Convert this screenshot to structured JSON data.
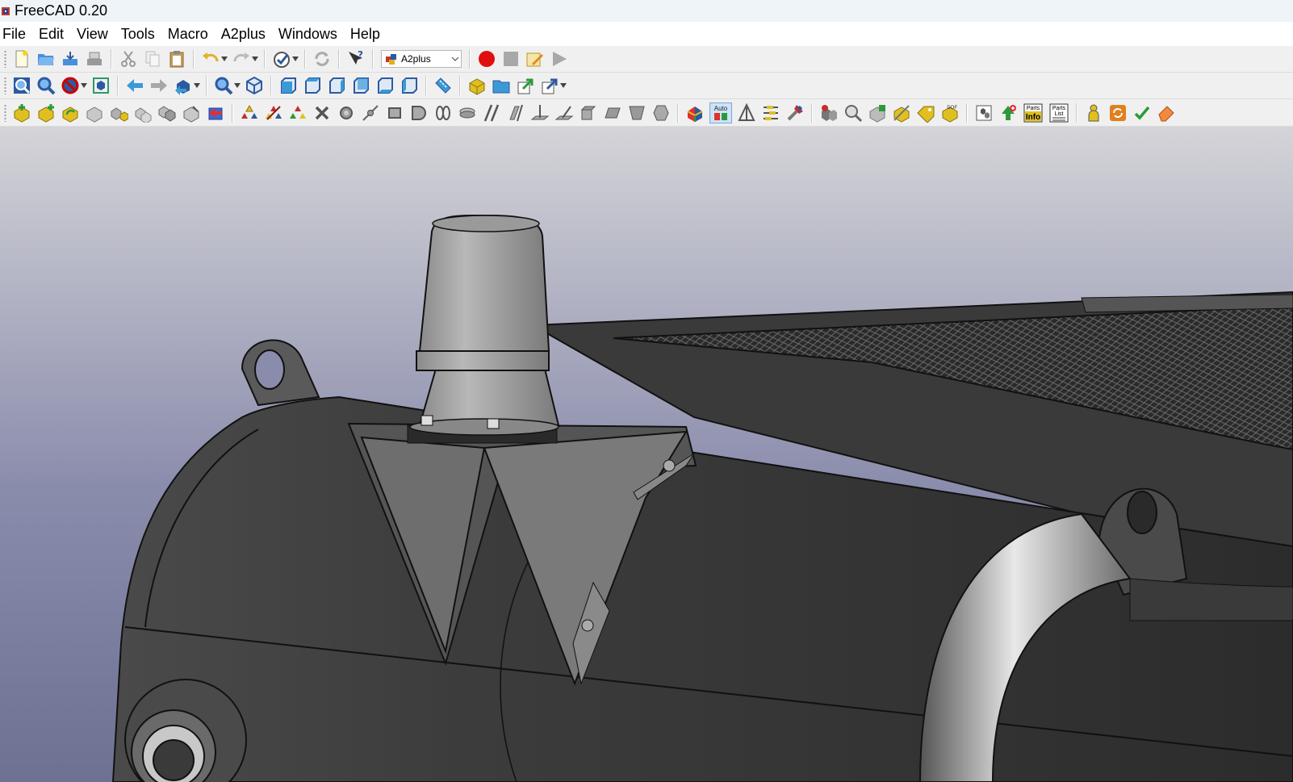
{
  "window": {
    "title": "FreeCAD 0.20"
  },
  "menu": [
    "File",
    "Edit",
    "View",
    "Tools",
    "Macro",
    "A2plus",
    "Windows",
    "Help"
  ],
  "toolbar1": {
    "workbench_selector": {
      "value": "A2plus"
    },
    "icons": [
      "new-file-icon",
      "open-file-icon",
      "import-icon",
      "export-icon",
      "cut-icon",
      "copy-icon",
      "paste-icon",
      "undo-icon",
      "redo-icon",
      "workbench-check-icon",
      "refresh-icon",
      "whats-this-icon",
      "macro-record-icon",
      "macro-stop-icon",
      "macro-edit-icon",
      "macro-run-icon"
    ]
  },
  "toolbar2": {
    "icons": [
      "fit-all-icon",
      "fit-selection-icon",
      "draw-style-icon",
      "bounding-box-icon",
      "nav-back-icon",
      "nav-forward-icon",
      "sync-view-icon",
      "std-zoom-icon",
      "isometric-view-icon",
      "front-view-icon",
      "top-view-icon",
      "right-view-icon",
      "rear-view-icon",
      "bottom-view-icon",
      "left-view-icon",
      "measure-icon",
      "part-icon",
      "group-icon",
      "link-make-icon",
      "link-actions-icon"
    ]
  },
  "toolbar3": {
    "auto_label": "Auto",
    "parts_info_label_top": "Parts",
    "parts_info_label_bottom": "Info",
    "parts_list_label_top": "Parts",
    "parts_list_label_bottom": "List",
    "dof_label": "DOF"
  },
  "viewport": {
    "background_top": "#d4d4d8",
    "background_bottom": "#6d7192"
  }
}
